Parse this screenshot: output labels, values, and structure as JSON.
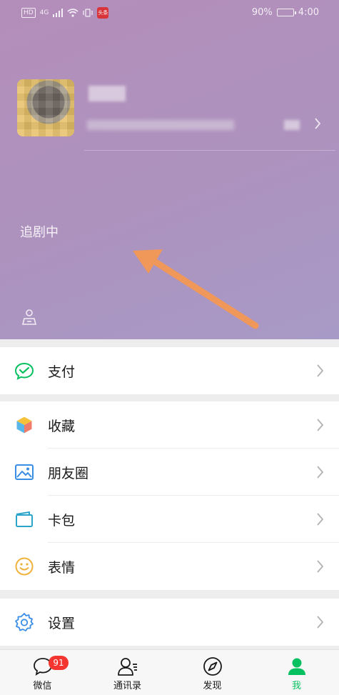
{
  "status_bar": {
    "network_tag": "HD",
    "signal_tag": "4G",
    "battery_percent": "90%",
    "battery_level": 0.9,
    "time": "4:00",
    "app_badge_text": "头条"
  },
  "profile": {
    "status_text": "追剧中"
  },
  "menu": {
    "pay": {
      "label": "支付",
      "icon": "wechat-pay-icon"
    },
    "favorites": {
      "label": "收藏",
      "icon": "favorites-cube-icon"
    },
    "moments": {
      "label": "朋友圈",
      "icon": "moments-photo-icon"
    },
    "cards": {
      "label": "卡包",
      "icon": "card-wallet-icon"
    },
    "stickers": {
      "label": "表情",
      "icon": "smiley-icon"
    },
    "settings": {
      "label": "设置",
      "icon": "gear-icon"
    }
  },
  "tabbar": {
    "chats": {
      "label": "微信",
      "badge": "91"
    },
    "contacts": {
      "label": "通讯录"
    },
    "discover": {
      "label": "发现"
    },
    "me": {
      "label": "我"
    }
  },
  "colors": {
    "accent": "#07c160",
    "header_top": "#b48eba",
    "header_bottom": "#a89ac6",
    "arrow": "#f0975a",
    "badge": "#f43530"
  }
}
